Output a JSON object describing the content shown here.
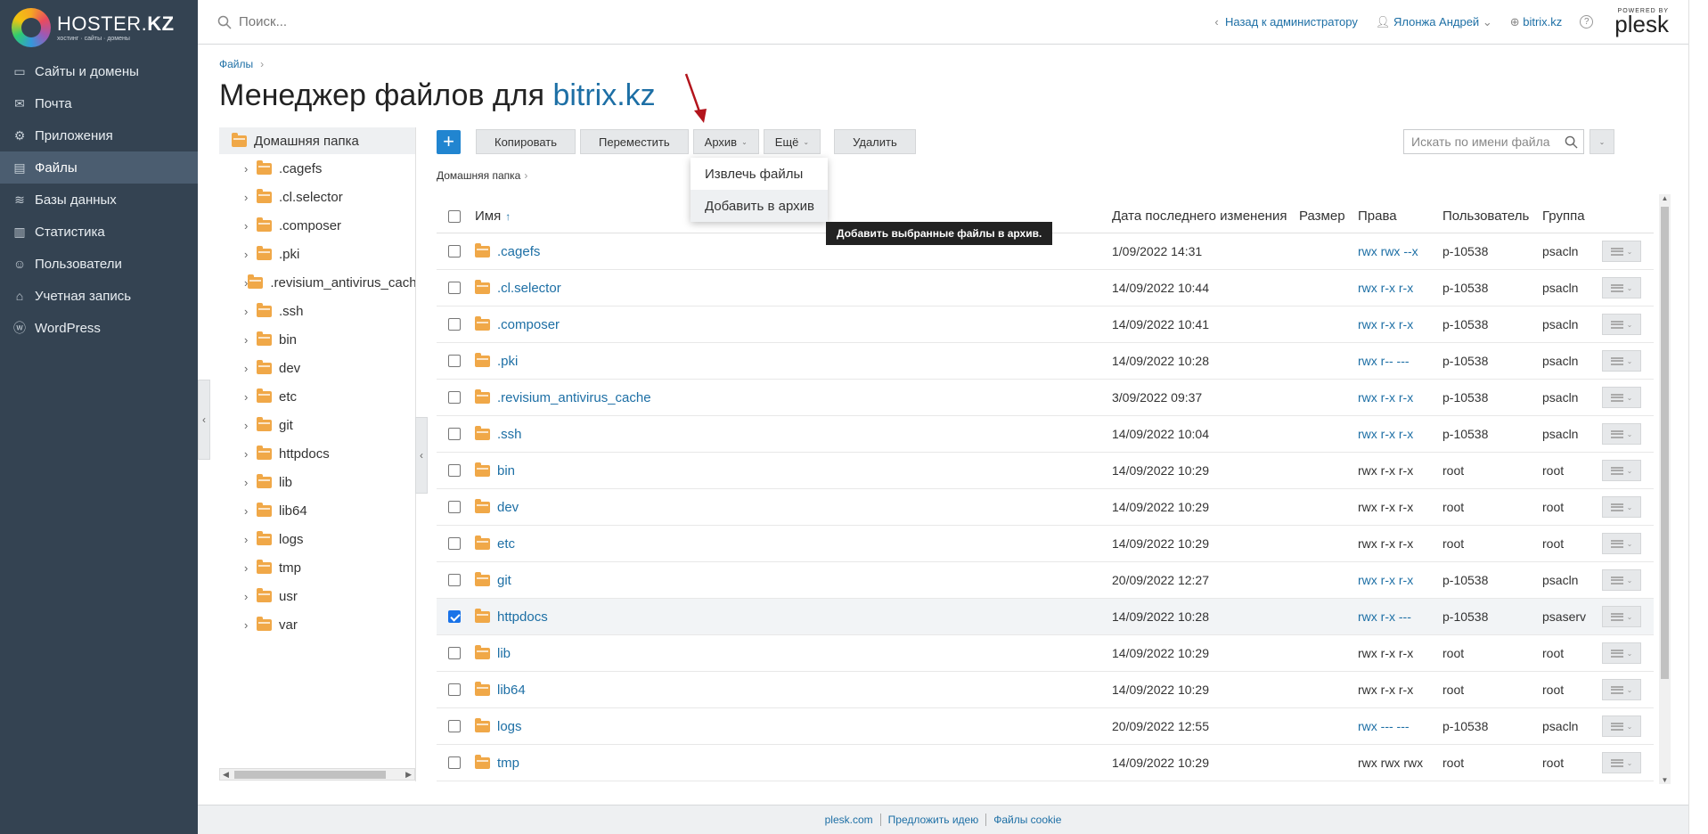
{
  "brand": {
    "name_regular": "HOSTER.",
    "name_bold": "KZ",
    "tagline": "хостинг · сайты · домены"
  },
  "sidebar": {
    "items": [
      {
        "label": "Сайты и домены",
        "icon": "monitor-icon",
        "active": false
      },
      {
        "label": "Почта",
        "icon": "mail-icon",
        "active": false
      },
      {
        "label": "Приложения",
        "icon": "gear-icon",
        "active": false
      },
      {
        "label": "Файлы",
        "icon": "file-icon",
        "active": true
      },
      {
        "label": "Базы данных",
        "icon": "database-icon",
        "active": false
      },
      {
        "label": "Статистика",
        "icon": "chart-icon",
        "active": false
      },
      {
        "label": "Пользователи",
        "icon": "user-icon",
        "active": false
      },
      {
        "label": "Учетная запись",
        "icon": "account-icon",
        "active": false
      },
      {
        "label": "WordPress",
        "icon": "wordpress-icon",
        "active": false
      }
    ]
  },
  "topbar": {
    "search_placeholder": "Поиск...",
    "back_link": "Назад к администратору",
    "user": "Ялонжа Андрей",
    "domain": "bitrix.kz",
    "plesk_powered": "POWERED BY",
    "plesk_word": "plesk"
  },
  "page": {
    "breadcrumb": "Файлы",
    "title_prefix": "Менеджер файлов для ",
    "title_domain": "bitrix.kz"
  },
  "tree": {
    "root": "Домашняя папка",
    "items": [
      ".cagefs",
      ".cl.selector",
      ".composer",
      ".pki",
      ".revisium_antivirus_cache",
      ".ssh",
      "bin",
      "dev",
      "etc",
      "git",
      "httpdocs",
      "lib",
      "lib64",
      "logs",
      "tmp",
      "usr",
      "var"
    ]
  },
  "toolbar": {
    "copy": "Копировать",
    "move": "Переместить",
    "archive": "Архив",
    "more": "Ещё",
    "delete": "Удалить",
    "search_placeholder": "Искать по имени файла"
  },
  "archive_menu": {
    "extract": "Извлечь файлы",
    "add": "Добавить в архив",
    "tooltip": "Добавить выбранные файлы в архив."
  },
  "content_breadcrumb": "Домашняя папка",
  "table": {
    "columns": {
      "name": "Имя",
      "date": "Дата последнего изменения",
      "size": "Размер",
      "perms": "Права",
      "user": "Пользователь",
      "group": "Группа"
    },
    "rows": [
      {
        "name": ".cagefs",
        "date": "1/09/2022 14:31",
        "size": "",
        "perms": "rwx rwx --x",
        "perm_link": true,
        "user": "p-10538",
        "group": "psacln",
        "checked": false
      },
      {
        "name": ".cl.selector",
        "date": "14/09/2022 10:44",
        "size": "",
        "perms": "rwx r-x r-x",
        "perm_link": true,
        "user": "p-10538",
        "group": "psacln",
        "checked": false
      },
      {
        "name": ".composer",
        "date": "14/09/2022 10:41",
        "size": "",
        "perms": "rwx r-x r-x",
        "perm_link": true,
        "user": "p-10538",
        "group": "psacln",
        "checked": false
      },
      {
        "name": ".pki",
        "date": "14/09/2022 10:28",
        "size": "",
        "perms": "rwx r-- ---",
        "perm_link": true,
        "user": "p-10538",
        "group": "psacln",
        "checked": false
      },
      {
        "name": ".revisium_antivirus_cache",
        "date": "3/09/2022 09:37",
        "size": "",
        "perms": "rwx r-x r-x",
        "perm_link": true,
        "user": "p-10538",
        "group": "psacln",
        "checked": false
      },
      {
        "name": ".ssh",
        "date": "14/09/2022 10:04",
        "size": "",
        "perms": "rwx r-x r-x",
        "perm_link": true,
        "user": "p-10538",
        "group": "psacln",
        "checked": false
      },
      {
        "name": "bin",
        "date": "14/09/2022 10:29",
        "size": "",
        "perms": "rwx r-x r-x",
        "perm_link": false,
        "user": "root",
        "group": "root",
        "checked": false
      },
      {
        "name": "dev",
        "date": "14/09/2022 10:29",
        "size": "",
        "perms": "rwx r-x r-x",
        "perm_link": false,
        "user": "root",
        "group": "root",
        "checked": false
      },
      {
        "name": "etc",
        "date": "14/09/2022 10:29",
        "size": "",
        "perms": "rwx r-x r-x",
        "perm_link": false,
        "user": "root",
        "group": "root",
        "checked": false
      },
      {
        "name": "git",
        "date": "20/09/2022 12:27",
        "size": "",
        "perms": "rwx r-x r-x",
        "perm_link": true,
        "user": "p-10538",
        "group": "psacln",
        "checked": false
      },
      {
        "name": "httpdocs",
        "date": "14/09/2022 10:28",
        "size": "",
        "perms": "rwx r-x ---",
        "perm_link": true,
        "user": "p-10538",
        "group": "psaserv",
        "checked": true
      },
      {
        "name": "lib",
        "date": "14/09/2022 10:29",
        "size": "",
        "perms": "rwx r-x r-x",
        "perm_link": false,
        "user": "root",
        "group": "root",
        "checked": false
      },
      {
        "name": "lib64",
        "date": "14/09/2022 10:29",
        "size": "",
        "perms": "rwx r-x r-x",
        "perm_link": false,
        "user": "root",
        "group": "root",
        "checked": false
      },
      {
        "name": "logs",
        "date": "20/09/2022 12:55",
        "size": "",
        "perms": "rwx --- ---",
        "perm_link": true,
        "user": "p-10538",
        "group": "psacln",
        "checked": false
      },
      {
        "name": "tmp",
        "date": "14/09/2022 10:29",
        "size": "",
        "perms": "rwx rwx rwx",
        "perm_link": false,
        "user": "root",
        "group": "root",
        "checked": false
      }
    ]
  },
  "footer": {
    "links": [
      "plesk.com",
      "Предложить идею",
      "Файлы cookie"
    ]
  },
  "colors": {
    "sidebar_bg": "#344352",
    "accent": "#2185d0",
    "link": "#1d6fa5",
    "folder": "#f0a848",
    "annotation_arrow": "#b3141c"
  }
}
